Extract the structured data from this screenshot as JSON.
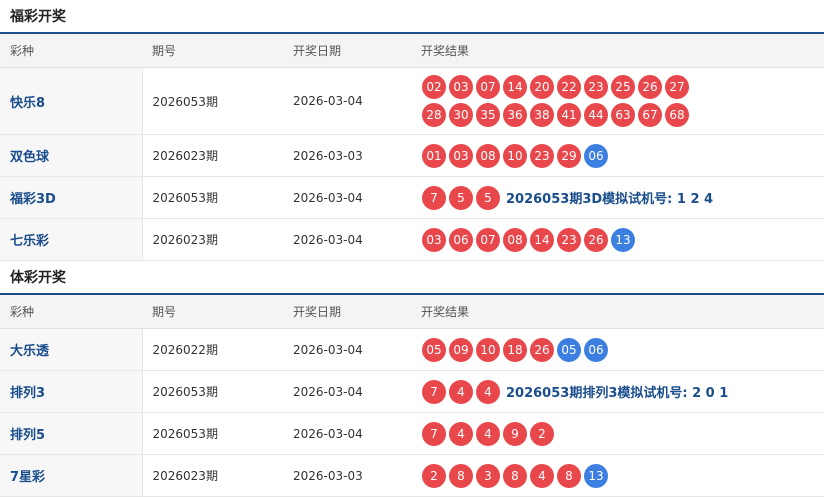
{
  "fucai": {
    "title": "福彩开奖",
    "headers": [
      "彩种",
      "期号",
      "开奖日期",
      "开奖结果"
    ],
    "rows": [
      {
        "name": "快乐8",
        "issue": "2026053期",
        "date": "2026-03-04",
        "red": [
          "02",
          "03",
          "07",
          "14",
          "20",
          "22",
          "23",
          "25",
          "26",
          "27",
          "28",
          "30",
          "35",
          "36",
          "38",
          "41",
          "44",
          "63",
          "67",
          "68"
        ],
        "blue": [],
        "trial": ""
      },
      {
        "name": "双色球",
        "issue": "2026023期",
        "date": "2026-03-03",
        "red": [
          "01",
          "03",
          "08",
          "10",
          "23",
          "29"
        ],
        "blue": [
          "06"
        ],
        "trial": ""
      },
      {
        "name": "福彩3D",
        "issue": "2026053期",
        "date": "2026-03-04",
        "red": [
          "7",
          "5",
          "5"
        ],
        "blue": [],
        "trial": "2026053期3D模拟试机号: 1 2 4"
      },
      {
        "name": "七乐彩",
        "issue": "2026023期",
        "date": "2026-03-04",
        "red": [
          "03",
          "06",
          "07",
          "08",
          "14",
          "23",
          "26"
        ],
        "blue": [
          "13"
        ],
        "trial": ""
      }
    ]
  },
  "ticai": {
    "title": "体彩开奖",
    "headers": [
      "彩种",
      "期号",
      "开奖日期",
      "开奖结果"
    ],
    "rows": [
      {
        "name": "大乐透",
        "issue": "2026022期",
        "date": "2026-03-04",
        "red": [
          "05",
          "09",
          "10",
          "18",
          "26"
        ],
        "blue": [
          "05",
          "06"
        ],
        "trial": ""
      },
      {
        "name": "排列3",
        "issue": "2026053期",
        "date": "2026-03-04",
        "red": [
          "7",
          "4",
          "4"
        ],
        "blue": [],
        "trial": "2026053期排列3模拟试机号: 2 0 1"
      },
      {
        "name": "排列5",
        "issue": "2026053期",
        "date": "2026-03-04",
        "red": [
          "7",
          "4",
          "4",
          "9",
          "2"
        ],
        "blue": [],
        "trial": ""
      },
      {
        "name": "7星彩",
        "issue": "2026023期",
        "date": "2026-03-03",
        "red": [
          "2",
          "8",
          "3",
          "8",
          "4",
          "8"
        ],
        "blue": [
          "13"
        ],
        "trial": ""
      }
    ]
  },
  "colors": {
    "red_ball": "#e8474b",
    "blue_ball": "#3d7fe0",
    "link": "#1a4d8c",
    "header_rule": "#1f4e85"
  }
}
